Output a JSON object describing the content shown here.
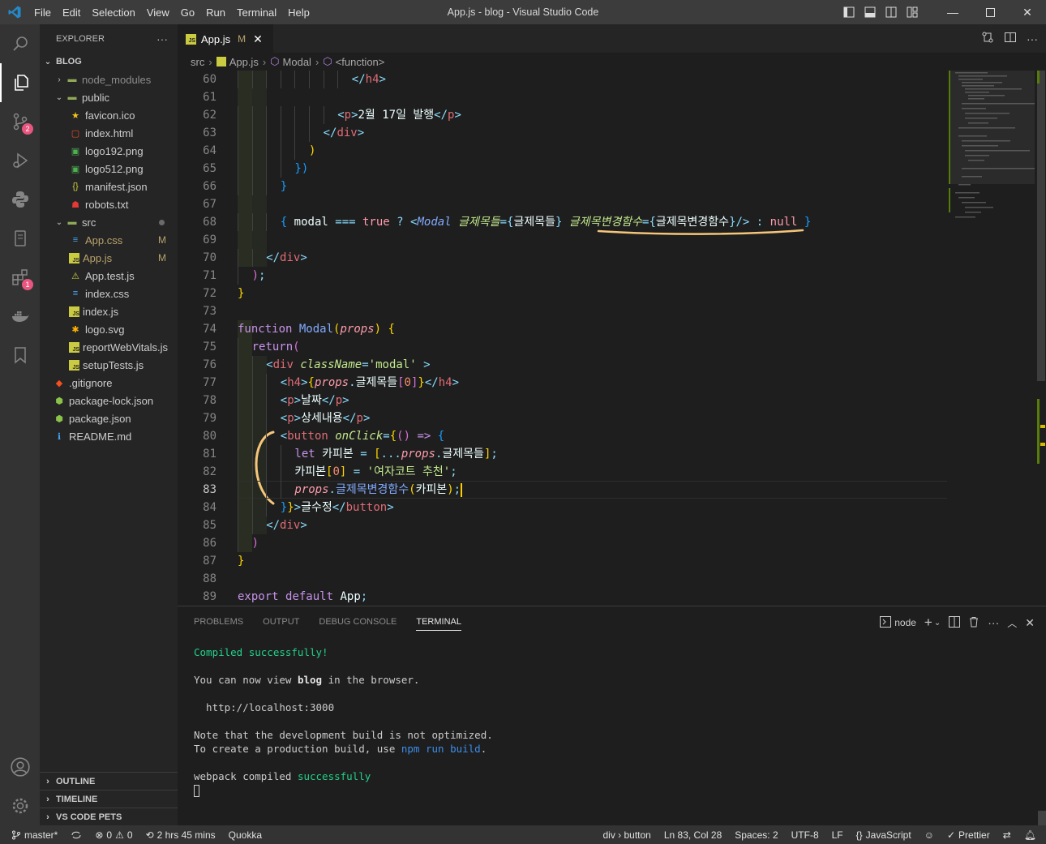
{
  "window": {
    "title": "App.js - blog - Visual Studio Code"
  },
  "menu": [
    "File",
    "Edit",
    "Selection",
    "View",
    "Go",
    "Run",
    "Terminal",
    "Help"
  ],
  "sidebar": {
    "header": "EXPLORER",
    "more": "···",
    "workspace": "BLOG",
    "tree": [
      {
        "label": "node_modules",
        "type": "folder",
        "open": false,
        "depth": 0,
        "muted": true
      },
      {
        "label": "public",
        "type": "folder",
        "open": true,
        "depth": 0
      },
      {
        "label": "favicon.ico",
        "type": "ico",
        "depth": 1
      },
      {
        "label": "index.html",
        "type": "html",
        "depth": 1
      },
      {
        "label": "logo192.png",
        "type": "png",
        "depth": 1
      },
      {
        "label": "logo512.png",
        "type": "png",
        "depth": 1
      },
      {
        "label": "manifest.json",
        "type": "json",
        "depth": 1
      },
      {
        "label": "robots.txt",
        "type": "txt",
        "depth": 1
      },
      {
        "label": "src",
        "type": "folder",
        "open": true,
        "depth": 0,
        "dot": true
      },
      {
        "label": "App.css",
        "type": "css",
        "depth": 1,
        "status": "M"
      },
      {
        "label": "App.js",
        "type": "js",
        "depth": 1,
        "status": "M"
      },
      {
        "label": "App.test.js",
        "type": "test",
        "depth": 1
      },
      {
        "label": "index.css",
        "type": "css",
        "depth": 1
      },
      {
        "label": "index.js",
        "type": "js",
        "depth": 1
      },
      {
        "label": "logo.svg",
        "type": "svg",
        "depth": 1
      },
      {
        "label": "reportWebVitals.js",
        "type": "js",
        "depth": 1
      },
      {
        "label": "setupTests.js",
        "type": "js",
        "depth": 1
      },
      {
        "label": ".gitignore",
        "type": "git",
        "depth": 0
      },
      {
        "label": "package-lock.json",
        "type": "node",
        "depth": 0
      },
      {
        "label": "package.json",
        "type": "node",
        "depth": 0
      },
      {
        "label": "README.md",
        "type": "info",
        "depth": 0
      }
    ],
    "bottom_sections": [
      "OUTLINE",
      "TIMELINE",
      "VS CODE PETS"
    ]
  },
  "activity_badges": {
    "scm": "2",
    "extensions": "1"
  },
  "tab": {
    "name": "App.js",
    "status": "M",
    "close": "✕"
  },
  "breadcrumb": [
    "src",
    "App.js",
    "Modal",
    "<function>"
  ],
  "editor": {
    "current_line": 83,
    "lines": [
      {
        "n": 60,
        "html": "<span class=\"c-punc\">&lt;/</span><span class=\"c-tag\">h4</span><span class=\"c-punc\">&gt;</span>",
        "indent": 8
      },
      {
        "n": 61,
        "html": "",
        "indent": 0
      },
      {
        "n": 62,
        "html": "<span class=\"c-punc\">&lt;</span><span class=\"c-tag\">p</span><span class=\"c-punc\">&gt;</span><span class=\"c-txt\">2월 17일 발행</span><span class=\"c-punc\">&lt;/</span><span class=\"c-tag\">p</span><span class=\"c-punc\">&gt;</span>",
        "indent": 7
      },
      {
        "n": 63,
        "html": "<span class=\"c-punc\">&lt;/</span><span class=\"c-tag\">div</span><span class=\"c-punc\">&gt;</span>",
        "indent": 6
      },
      {
        "n": 64,
        "html": "<span class=\"c-yel\">)</span>",
        "indent": 5
      },
      {
        "n": 65,
        "html": "<span class=\"c-blue\">})</span>",
        "indent": 4
      },
      {
        "n": 66,
        "html": "<span class=\"c-blue\">}</span>",
        "indent": 3
      },
      {
        "n": 67,
        "html": "",
        "indent": 0
      },
      {
        "n": 68,
        "html": "<span class=\"c-blue\">{</span> <span class=\"c-var\">modal</span> <span class=\"c-punc\">===</span> <span class=\"c-bool\">true</span> <span class=\"c-punc\">?</span> <span class=\"c-punc\">&lt;</span><span class=\"c-comp\">Modal</span> <span class=\"c-attr\">글제목들</span><span class=\"c-punc\">={</span><span class=\"c-var\">글제목들</span><span class=\"c-punc\">}</span> <span class=\"c-attr\">글제목변경함수</span><span class=\"c-punc\">={</span><span class=\"c-var\">글제목변경함수</span><span class=\"c-punc\">}/&gt;</span> <span class=\"c-punc\">:</span> <span class=\"c-bool\">null</span> <span class=\"c-blue\">}</span>",
        "indent": 3
      },
      {
        "n": 69,
        "html": "",
        "indent": 0
      },
      {
        "n": 70,
        "html": "<span class=\"c-punc\">&lt;/</span><span class=\"c-tag\">div</span><span class=\"c-punc\">&gt;</span>",
        "indent": 2
      },
      {
        "n": 71,
        "html": "<span class=\"c-pink\">)</span><span class=\"c-punc\">;</span>",
        "indent": 1
      },
      {
        "n": 72,
        "html": "<span class=\"c-yel\">}</span>",
        "indent": 0
      },
      {
        "n": 73,
        "html": "",
        "indent": 0
      },
      {
        "n": 74,
        "html": "<span class=\"k-kw\">function</span> <span class=\"c-fn\">Modal</span><span class=\"c-yel\">(</span><span class=\"c-prop\">props</span><span class=\"c-yel\">)</span> <span class=\"c-yel\">{</span>",
        "indent": 0
      },
      {
        "n": 75,
        "html": "<span class=\"k-kw\">return</span><span class=\"c-pink\">(</span>",
        "indent": 1
      },
      {
        "n": 76,
        "html": "<span class=\"c-punc\">&lt;</span><span class=\"c-tag\">div</span> <span class=\"c-attr\">className</span><span class=\"c-punc\">=</span><span class=\"c-str\">'modal'</span> <span class=\"c-punc\">&gt;</span>",
        "indent": 2
      },
      {
        "n": 77,
        "html": "<span class=\"c-punc\">&lt;</span><span class=\"c-tag\">h4</span><span class=\"c-punc\">&gt;</span><span class=\"c-yel\">{</span><span class=\"c-prop\">props</span><span class=\"c-punc\">.</span><span class=\"c-var\">글제목들</span><span class=\"c-pink\">[</span><span class=\"c-num\">0</span><span class=\"c-pink\">]</span><span class=\"c-yel\">}</span><span class=\"c-punc\">&lt;/</span><span class=\"c-tag\">h4</span><span class=\"c-punc\">&gt;</span>",
        "indent": 3
      },
      {
        "n": 78,
        "html": "<span class=\"c-punc\">&lt;</span><span class=\"c-tag\">p</span><span class=\"c-punc\">&gt;</span><span class=\"c-txt\">날짜</span><span class=\"c-punc\">&lt;/</span><span class=\"c-tag\">p</span><span class=\"c-punc\">&gt;</span>",
        "indent": 3
      },
      {
        "n": 79,
        "html": "<span class=\"c-punc\">&lt;</span><span class=\"c-tag\">p</span><span class=\"c-punc\">&gt;</span><span class=\"c-txt\">상세내용</span><span class=\"c-punc\">&lt;/</span><span class=\"c-tag\">p</span><span class=\"c-punc\">&gt;</span>",
        "indent": 3
      },
      {
        "n": 80,
        "html": "<span class=\"c-punc\">&lt;</span><span class=\"c-tag\">button</span> <span class=\"c-attr\">onClick</span><span class=\"c-punc\">=</span><span class=\"c-yel\">{</span><span class=\"c-pink\">()</span> <span class=\"k-kw\">=&gt;</span> <span class=\"c-blue\">{</span>",
        "indent": 3
      },
      {
        "n": 81,
        "html": "<span class=\"k-kw\">let</span> <span class=\"c-var\">카피본</span> <span class=\"c-punc\">=</span> <span class=\"c-yel\">[</span><span class=\"c-punc\">...</span><span class=\"c-prop\">props</span><span class=\"c-punc\">.</span><span class=\"c-var\">글제목들</span><span class=\"c-yel\">]</span><span class=\"c-punc\">;</span>",
        "indent": 4
      },
      {
        "n": 82,
        "html": "<span class=\"c-var\">카피본</span><span class=\"c-yel\">[</span><span class=\"c-num\">0</span><span class=\"c-yel\">]</span> <span class=\"c-punc\">=</span> <span class=\"c-str\">'여자코트 추천'</span><span class=\"c-punc\">;</span>",
        "indent": 4
      },
      {
        "n": 83,
        "html": "<span class=\"c-prop\">props</span><span class=\"c-punc\">.</span><span class=\"c-fn\">글제목변경함수</span><span class=\"c-yel\">(</span><span class=\"c-var\">카피본</span><span class=\"c-yel\">)</span><span class=\"c-punc\">;</span>",
        "indent": 4
      },
      {
        "n": 84,
        "html": "<span class=\"c-blue\">}</span><span class=\"c-yel\">}</span><span class=\"c-punc\">&gt;</span><span class=\"c-txt\">글수정</span><span class=\"c-punc\">&lt;/</span><span class=\"c-tag\">button</span><span class=\"c-punc\">&gt;</span>",
        "indent": 3
      },
      {
        "n": 85,
        "html": "<span class=\"c-punc\">&lt;/</span><span class=\"c-tag\">div</span><span class=\"c-punc\">&gt;</span>",
        "indent": 2
      },
      {
        "n": 86,
        "html": "<span class=\"c-pink\">)</span>",
        "indent": 1
      },
      {
        "n": 87,
        "html": "<span class=\"c-yel\">}</span>",
        "indent": 0
      },
      {
        "n": 88,
        "html": "",
        "indent": 0
      },
      {
        "n": 89,
        "html": "<span class=\"k-kw\">export</span> <span class=\"k-kw\">default</span> <span class=\"c-var\">App</span><span class=\"c-punc\">;</span>",
        "indent": 0
      }
    ]
  },
  "panel": {
    "tabs": [
      "PROBLEMS",
      "OUTPUT",
      "DEBUG CONSOLE",
      "TERMINAL"
    ],
    "active_tab": "TERMINAL",
    "terminal_name": "node",
    "terminal": {
      "compiled": "Compiled successfully!",
      "view_prefix": "You can now view ",
      "view_app": "blog",
      "view_suffix": " in the browser.",
      "url": "  http://localhost:3000",
      "note1": "Note that the development build is not optimized.",
      "note2_prefix": "To create a production build, use ",
      "note2_cmd": "npm run build",
      "note2_suffix": ".",
      "webpack_prefix": "webpack compiled ",
      "webpack_status": "successfully"
    }
  },
  "statusbar": {
    "branch": "master*",
    "errors": "0",
    "warnings": "0",
    "time": "2 hrs 45 mins",
    "quokka": "Quokka",
    "context": "div › button",
    "position": "Ln 83, Col 28",
    "spaces": "Spaces: 2",
    "encoding": "UTF-8",
    "eol": "LF",
    "language": "JavaScript",
    "prettier": "Prettier"
  }
}
